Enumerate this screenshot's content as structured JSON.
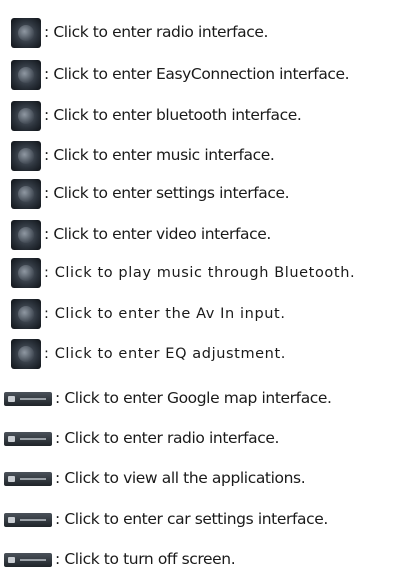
{
  "items": [
    {
      "icon": "radio-icon",
      "text": ": Click to enter radio interface."
    },
    {
      "icon": "easyconnection-icon",
      "text": ": Click to enter EasyConnection interface."
    },
    {
      "icon": "bluetooth-icon",
      "text": ": Click to enter bluetooth interface."
    },
    {
      "icon": "music-icon",
      "text": ": Click to enter music interface."
    },
    {
      "icon": "settings-icon",
      "text": ": Click to enter settings interface."
    },
    {
      "icon": "video-icon",
      "text": ":  Click to enter video interface."
    },
    {
      "icon": "bluetooth-music-icon",
      "text": ": Click to play music through Bluetooth."
    },
    {
      "icon": "av-in-icon",
      "text": ": Click to enter the Av In input."
    },
    {
      "icon": "eq-icon",
      "text": ": Click to enter EQ adjustment."
    },
    {
      "icon": "google-map-button-icon",
      "text": ": Click to enter Google map interface."
    },
    {
      "icon": "radio-button-icon",
      "text": ": Click to enter radio interface."
    },
    {
      "icon": "applications-button-icon",
      "text": ": Click to view all the applications."
    },
    {
      "icon": "car-settings-button-icon",
      "text": ": Click to enter car settings interface."
    },
    {
      "icon": "screen-off-button-icon",
      "text": ": Click to turn off screen."
    }
  ]
}
